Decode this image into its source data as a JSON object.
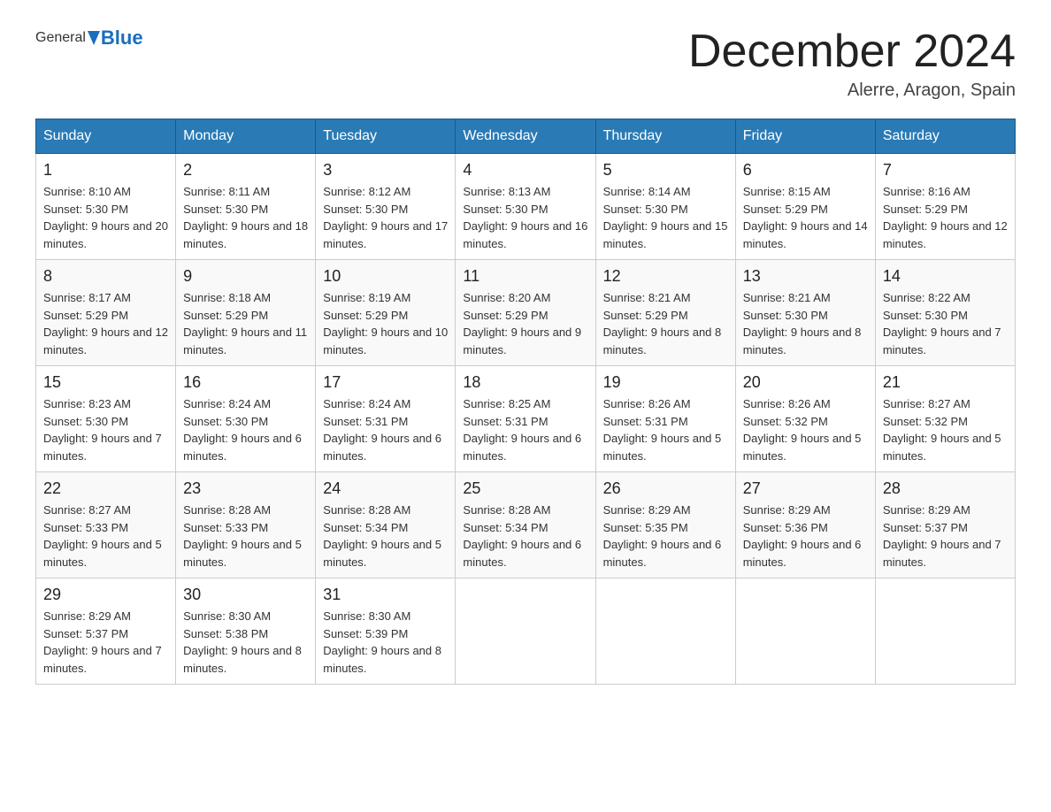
{
  "header": {
    "logo_general": "General",
    "logo_blue": "Blue",
    "month_title": "December 2024",
    "subtitle": "Alerre, Aragon, Spain"
  },
  "days_of_week": [
    "Sunday",
    "Monday",
    "Tuesday",
    "Wednesday",
    "Thursday",
    "Friday",
    "Saturday"
  ],
  "weeks": [
    [
      {
        "day": "1",
        "sunrise": "8:10 AM",
        "sunset": "5:30 PM",
        "daylight": "9 hours and 20 minutes."
      },
      {
        "day": "2",
        "sunrise": "8:11 AM",
        "sunset": "5:30 PM",
        "daylight": "9 hours and 18 minutes."
      },
      {
        "day": "3",
        "sunrise": "8:12 AM",
        "sunset": "5:30 PM",
        "daylight": "9 hours and 17 minutes."
      },
      {
        "day": "4",
        "sunrise": "8:13 AM",
        "sunset": "5:30 PM",
        "daylight": "9 hours and 16 minutes."
      },
      {
        "day": "5",
        "sunrise": "8:14 AM",
        "sunset": "5:30 PM",
        "daylight": "9 hours and 15 minutes."
      },
      {
        "day": "6",
        "sunrise": "8:15 AM",
        "sunset": "5:29 PM",
        "daylight": "9 hours and 14 minutes."
      },
      {
        "day": "7",
        "sunrise": "8:16 AM",
        "sunset": "5:29 PM",
        "daylight": "9 hours and 12 minutes."
      }
    ],
    [
      {
        "day": "8",
        "sunrise": "8:17 AM",
        "sunset": "5:29 PM",
        "daylight": "9 hours and 12 minutes."
      },
      {
        "day": "9",
        "sunrise": "8:18 AM",
        "sunset": "5:29 PM",
        "daylight": "9 hours and 11 minutes."
      },
      {
        "day": "10",
        "sunrise": "8:19 AM",
        "sunset": "5:29 PM",
        "daylight": "9 hours and 10 minutes."
      },
      {
        "day": "11",
        "sunrise": "8:20 AM",
        "sunset": "5:29 PM",
        "daylight": "9 hours and 9 minutes."
      },
      {
        "day": "12",
        "sunrise": "8:21 AM",
        "sunset": "5:29 PM",
        "daylight": "9 hours and 8 minutes."
      },
      {
        "day": "13",
        "sunrise": "8:21 AM",
        "sunset": "5:30 PM",
        "daylight": "9 hours and 8 minutes."
      },
      {
        "day": "14",
        "sunrise": "8:22 AM",
        "sunset": "5:30 PM",
        "daylight": "9 hours and 7 minutes."
      }
    ],
    [
      {
        "day": "15",
        "sunrise": "8:23 AM",
        "sunset": "5:30 PM",
        "daylight": "9 hours and 7 minutes."
      },
      {
        "day": "16",
        "sunrise": "8:24 AM",
        "sunset": "5:30 PM",
        "daylight": "9 hours and 6 minutes."
      },
      {
        "day": "17",
        "sunrise": "8:24 AM",
        "sunset": "5:31 PM",
        "daylight": "9 hours and 6 minutes."
      },
      {
        "day": "18",
        "sunrise": "8:25 AM",
        "sunset": "5:31 PM",
        "daylight": "9 hours and 6 minutes."
      },
      {
        "day": "19",
        "sunrise": "8:26 AM",
        "sunset": "5:31 PM",
        "daylight": "9 hours and 5 minutes."
      },
      {
        "day": "20",
        "sunrise": "8:26 AM",
        "sunset": "5:32 PM",
        "daylight": "9 hours and 5 minutes."
      },
      {
        "day": "21",
        "sunrise": "8:27 AM",
        "sunset": "5:32 PM",
        "daylight": "9 hours and 5 minutes."
      }
    ],
    [
      {
        "day": "22",
        "sunrise": "8:27 AM",
        "sunset": "5:33 PM",
        "daylight": "9 hours and 5 minutes."
      },
      {
        "day": "23",
        "sunrise": "8:28 AM",
        "sunset": "5:33 PM",
        "daylight": "9 hours and 5 minutes."
      },
      {
        "day": "24",
        "sunrise": "8:28 AM",
        "sunset": "5:34 PM",
        "daylight": "9 hours and 5 minutes."
      },
      {
        "day": "25",
        "sunrise": "8:28 AM",
        "sunset": "5:34 PM",
        "daylight": "9 hours and 6 minutes."
      },
      {
        "day": "26",
        "sunrise": "8:29 AM",
        "sunset": "5:35 PM",
        "daylight": "9 hours and 6 minutes."
      },
      {
        "day": "27",
        "sunrise": "8:29 AM",
        "sunset": "5:36 PM",
        "daylight": "9 hours and 6 minutes."
      },
      {
        "day": "28",
        "sunrise": "8:29 AM",
        "sunset": "5:37 PM",
        "daylight": "9 hours and 7 minutes."
      }
    ],
    [
      {
        "day": "29",
        "sunrise": "8:29 AM",
        "sunset": "5:37 PM",
        "daylight": "9 hours and 7 minutes."
      },
      {
        "day": "30",
        "sunrise": "8:30 AM",
        "sunset": "5:38 PM",
        "daylight": "9 hours and 8 minutes."
      },
      {
        "day": "31",
        "sunrise": "8:30 AM",
        "sunset": "5:39 PM",
        "daylight": "9 hours and 8 minutes."
      },
      null,
      null,
      null,
      null
    ]
  ]
}
